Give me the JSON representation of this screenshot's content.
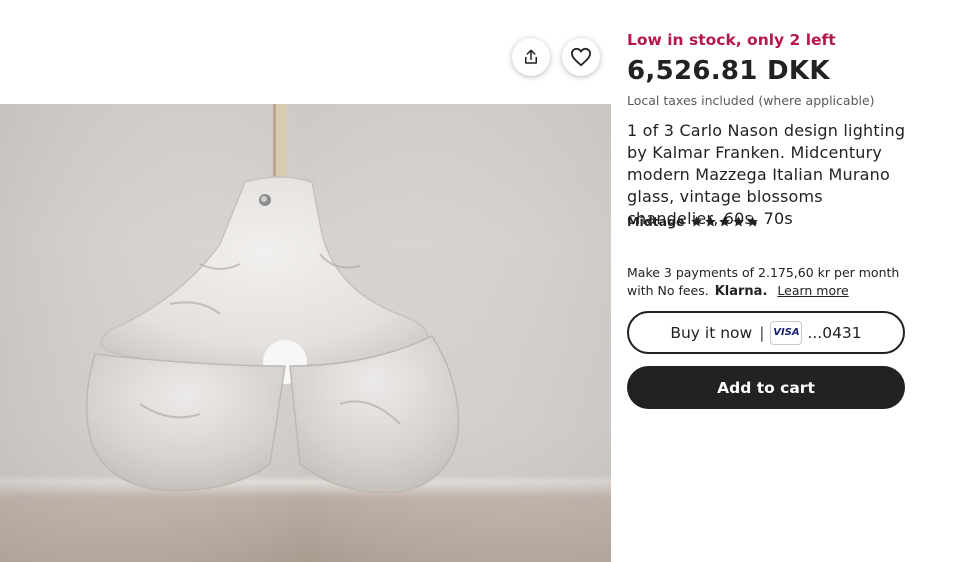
{
  "product_image": {
    "alt_icon": "pendant-lamp-photo"
  },
  "actions": {
    "share_icon": "share-icon",
    "favorite_icon": "heart-icon"
  },
  "listing": {
    "stock_text": "Low in stock, only 2 left",
    "price": "6,526.81 DKK",
    "taxes_note": "Local taxes included (where applicable)",
    "title": "1 of 3 Carlo Nason design lighting by Kalmar Franken. Midcentury modern Mazzega Italian Murano glass, vintage blossoms chandelier, 60s, 70s",
    "shop_name": "Midtage",
    "rating_stars": 5
  },
  "payments": {
    "installments_text": "Make 3 payments of 2.175,60 kr per month with No fees.",
    "provider": "Klarna.",
    "learn_more": "Learn more"
  },
  "buttons": {
    "buy_now_label": "Buy it now",
    "separator": "|",
    "card_brand": "VISA",
    "card_suffix": "...0431",
    "add_to_cart_label": "Add to cart"
  },
  "colors": {
    "stock_accent": "#b5194a",
    "primary_button": "#222222"
  }
}
